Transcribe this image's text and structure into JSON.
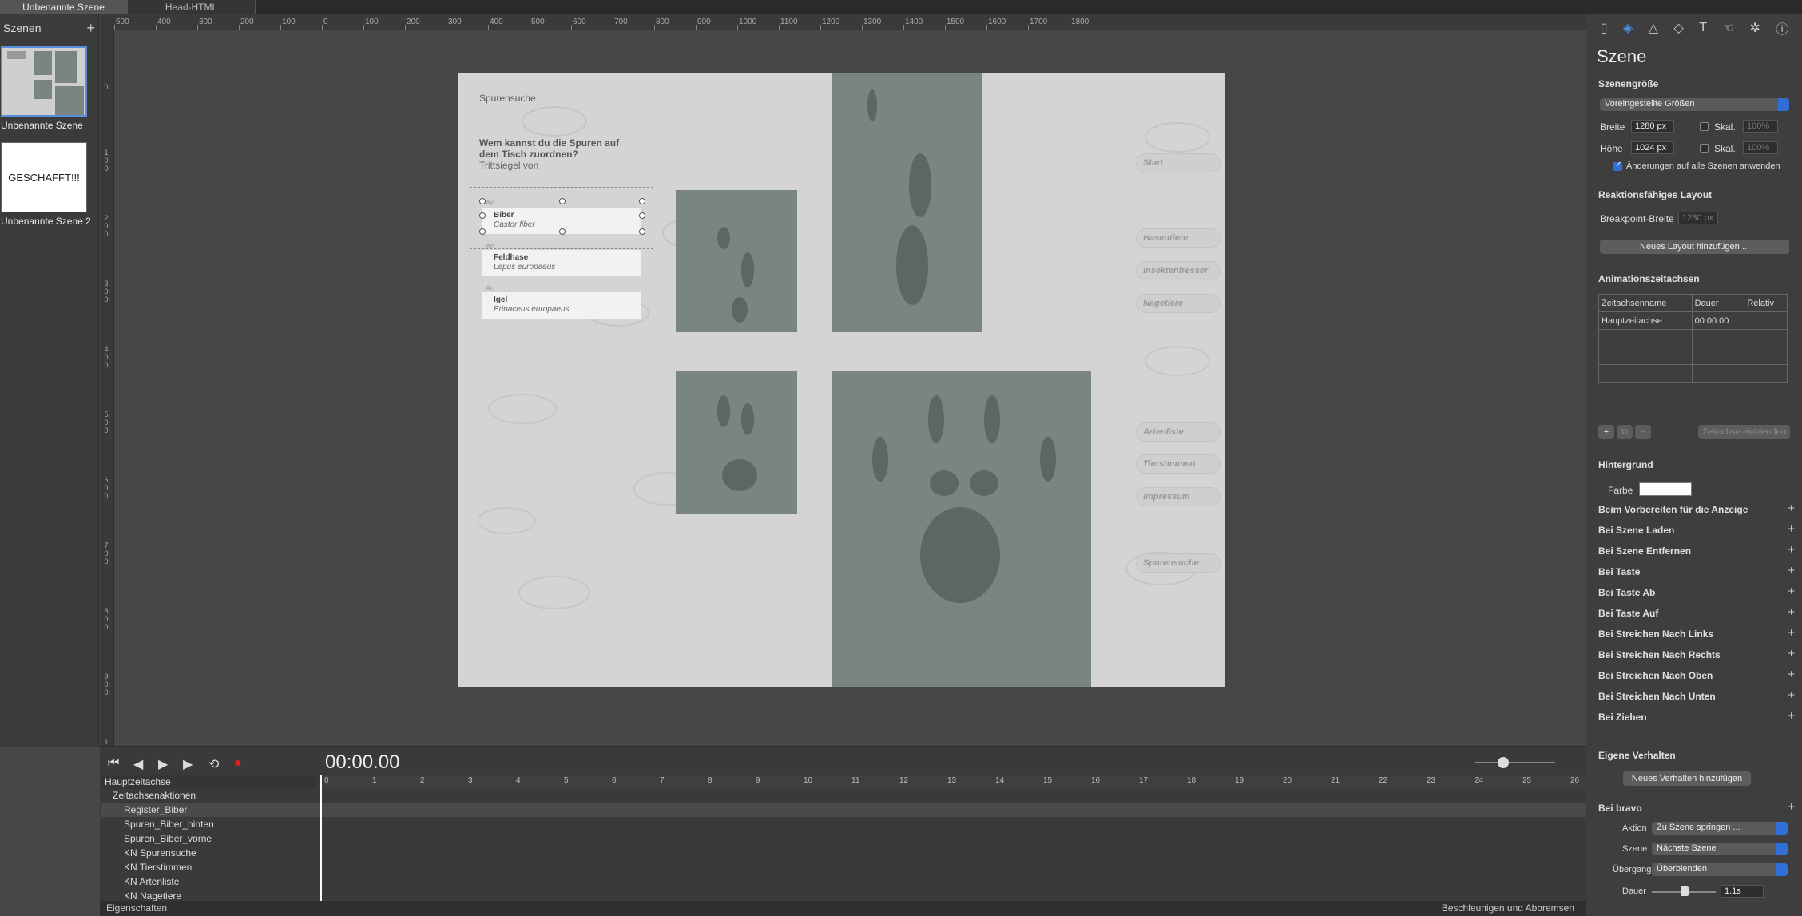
{
  "tabs": [
    "Unbenannte Szene",
    "Head-HTML"
  ],
  "scenes_panel": {
    "title": "Szenen",
    "scenes": [
      {
        "label": "Unbenannte Szene"
      },
      {
        "label": "Unbenannte Szene 2",
        "thumb_text": "GESCHAFFT!!!"
      }
    ]
  },
  "ruler_top": [
    "500",
    "400",
    "300",
    "200",
    "100",
    "0",
    "100",
    "200",
    "300",
    "400",
    "500",
    "600",
    "700",
    "800",
    "900",
    "1000",
    "1100",
    "1200",
    "1300",
    "1400",
    "1500",
    "1600",
    "1700",
    "1800"
  ],
  "ruler_left": [
    "0",
    "100",
    "200",
    "300",
    "400",
    "500",
    "600",
    "700",
    "800",
    "900",
    "1000",
    "1"
  ],
  "stage": {
    "title": "Spurensuche",
    "question": "Wem kannst du die Spuren auf dem Tisch zuordnen?",
    "subtitle": "Trittsiegel von",
    "cards": [
      {
        "small": "Art",
        "name": "Biber",
        "latin": "Castor fiber"
      },
      {
        "small": "Art",
        "name": "Feldhase",
        "latin": "Lepus europaeus"
      },
      {
        "small": "Art",
        "name": "Igel",
        "latin": "Erinaceus europaeus"
      }
    ],
    "nav_buttons": [
      "Start",
      "Hasentiere",
      "Insektenfresser",
      "Nagetiere",
      "Artenliste",
      "Tierstimmen",
      "Impressum",
      "Spurensuche"
    ]
  },
  "transport": {
    "timecode": "00:00.00"
  },
  "timeline": {
    "header": "Hauptzeitachse",
    "actions_row": "Zeitachsenaktionen",
    "layers": [
      "Register_Biber",
      "Spuren_Biber_hinten",
      "Spuren_Biber_vorne",
      "KN Spurensuche",
      "KN Tierstimmen",
      "KN Artenliste",
      "KN Nagetiere"
    ],
    "ticks": [
      "0",
      "1",
      "2",
      "3",
      "4",
      "5",
      "6",
      "7",
      "8",
      "9",
      "10",
      "11",
      "12",
      "13",
      "14",
      "15",
      "16",
      "17",
      "18",
      "19",
      "20",
      "21",
      "22",
      "23",
      "24",
      "25",
      "26"
    ],
    "properties_label": "Eigenschaften",
    "easing_label": "Beschleunigen und Abbremsen"
  },
  "inspector": {
    "title": "Szene",
    "scene_size": {
      "heading": "Szenengröße",
      "preset": "Voreingestellte Größen",
      "width_label": "Breite",
      "width_value": "1280 px",
      "height_label": "Höhe",
      "height_value": "1024 px",
      "scale_label": "Skal.",
      "scale_value": "100%",
      "apply_all": "Änderungen auf alle Szenen anwenden"
    },
    "responsive": {
      "heading": "Reaktionsfähiges Layout",
      "breakpoint_label": "Breakpoint-Breite",
      "breakpoint_value": "1280 px",
      "add_layout": "Neues Layout hinzufügen ..."
    },
    "timelines": {
      "heading": "Animationszeitachsen",
      "col_name": "Zeitachsenname",
      "col_duration": "Dauer",
      "col_relative": "Relativ",
      "row_name": "Hauptzeitachse",
      "row_duration": "00:00.00",
      "show_button": "Zeitachse einblenden"
    },
    "background": {
      "heading": "Hintergrund",
      "color_label": "Farbe",
      "color": "#ffffff"
    },
    "events": [
      "Beim Vorbereiten für die Anzeige",
      "Bei Szene Laden",
      "Bei Szene Entfernen",
      "Bei Taste",
      "Bei Taste Ab",
      "Bei Taste Auf",
      "Bei Streichen Nach Links",
      "Bei Streichen Nach Rechts",
      "Bei Streichen Nach Oben",
      "Bei Streichen Nach Unten",
      "Bei Ziehen"
    ],
    "custom": {
      "heading": "Eigene Verhalten",
      "add_button": "Neues Verhalten hinzufügen"
    },
    "bravo": {
      "heading": "Bei bravo",
      "action_label": "Aktion",
      "action_value": "Zu Szene springen ...",
      "scene_label": "Szene",
      "scene_value": "Nächste Szene",
      "transition_label": "Übergang",
      "transition_value": "Überblenden",
      "duration_label": "Dauer",
      "duration_value": "1.1s"
    }
  }
}
